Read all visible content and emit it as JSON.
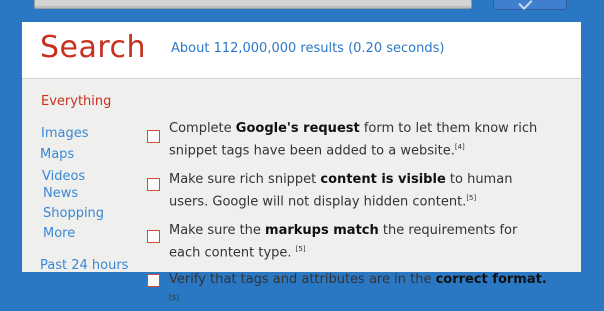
{
  "header": {
    "title": "Search",
    "results_text": "About 112,000,000 results (0.20 seconds)"
  },
  "sidebar": {
    "items": [
      {
        "label": "Everything",
        "active": true
      },
      {
        "label": "Images",
        "active": false
      },
      {
        "label": "Maps",
        "active": false
      },
      {
        "label": "Videos",
        "active": false
      },
      {
        "label": "News",
        "active": false
      },
      {
        "label": "Shopping",
        "active": false
      },
      {
        "label": "More",
        "active": false
      },
      {
        "label": "Past 24 hours",
        "active": false
      }
    ]
  },
  "checklist": [
    {
      "pre": "Complete ",
      "bold": "Google's request",
      "post": " form to let them know rich snippet tags have been added to a website.",
      "cite": "[4]"
    },
    {
      "pre": "Make sure rich snippet ",
      "bold": "content is visible",
      "post": " to human users. Google will not display hidden content.",
      "cite": "[5]"
    },
    {
      "pre": "Make sure the ",
      "bold": "markups match",
      "post": " the requirements for each content type. ",
      "cite": "[5]"
    },
    {
      "pre": "Verify that tags and attributes are in the ",
      "bold": "correct format.",
      "post": "",
      "cite": "[5]"
    }
  ],
  "colors": {
    "background": "#2a78c4",
    "title_red": "#c9301f",
    "link_blue": "#3a88d4",
    "body_gray": "#efefed"
  }
}
